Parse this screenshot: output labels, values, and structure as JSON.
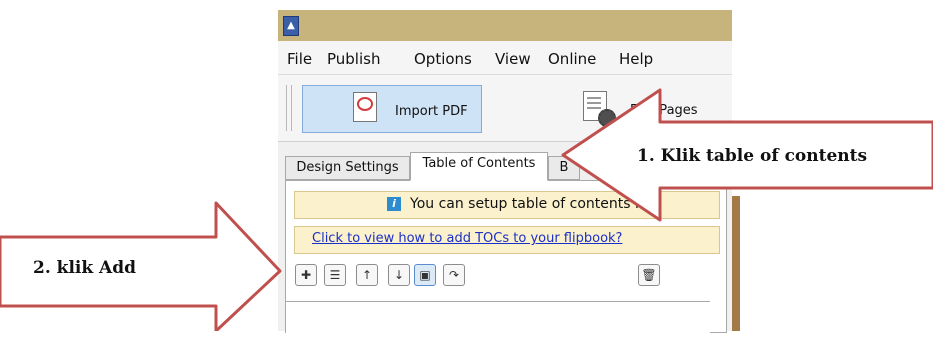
{
  "menu": {
    "file": "File",
    "publish": "Publish",
    "options": "Options",
    "view": "View",
    "online": "Online",
    "help": "Help"
  },
  "toolbar": {
    "import_pdf_label": "Import PDF",
    "edit_pages_label": "Edit Pages"
  },
  "tabs": {
    "design_settings": "Design Settings",
    "table_of_contents": "Table of Contents",
    "third_tab_partial": "B"
  },
  "toc_panel": {
    "info_text": "You can setup table of contents he",
    "help_link": "Click to view how to add TOCs to your flipbook?"
  },
  "annotations": {
    "step1": "1. Klik table of contents",
    "step2": "2. klik Add"
  },
  "colors": {
    "titlebar": "#c7b37c",
    "arrow_fill": "#ffffff",
    "arrow_stroke": "#c0504d",
    "info_bar": "#fbf1cd",
    "link": "#1a30c8"
  },
  "icons": [
    "app-icon",
    "pdf-icon",
    "edit-pages-icon",
    "info-icon",
    "add-icon",
    "list-properties-icon",
    "move-up-icon",
    "move-down-icon",
    "save-icon",
    "redo-icon",
    "delete-icon"
  ]
}
